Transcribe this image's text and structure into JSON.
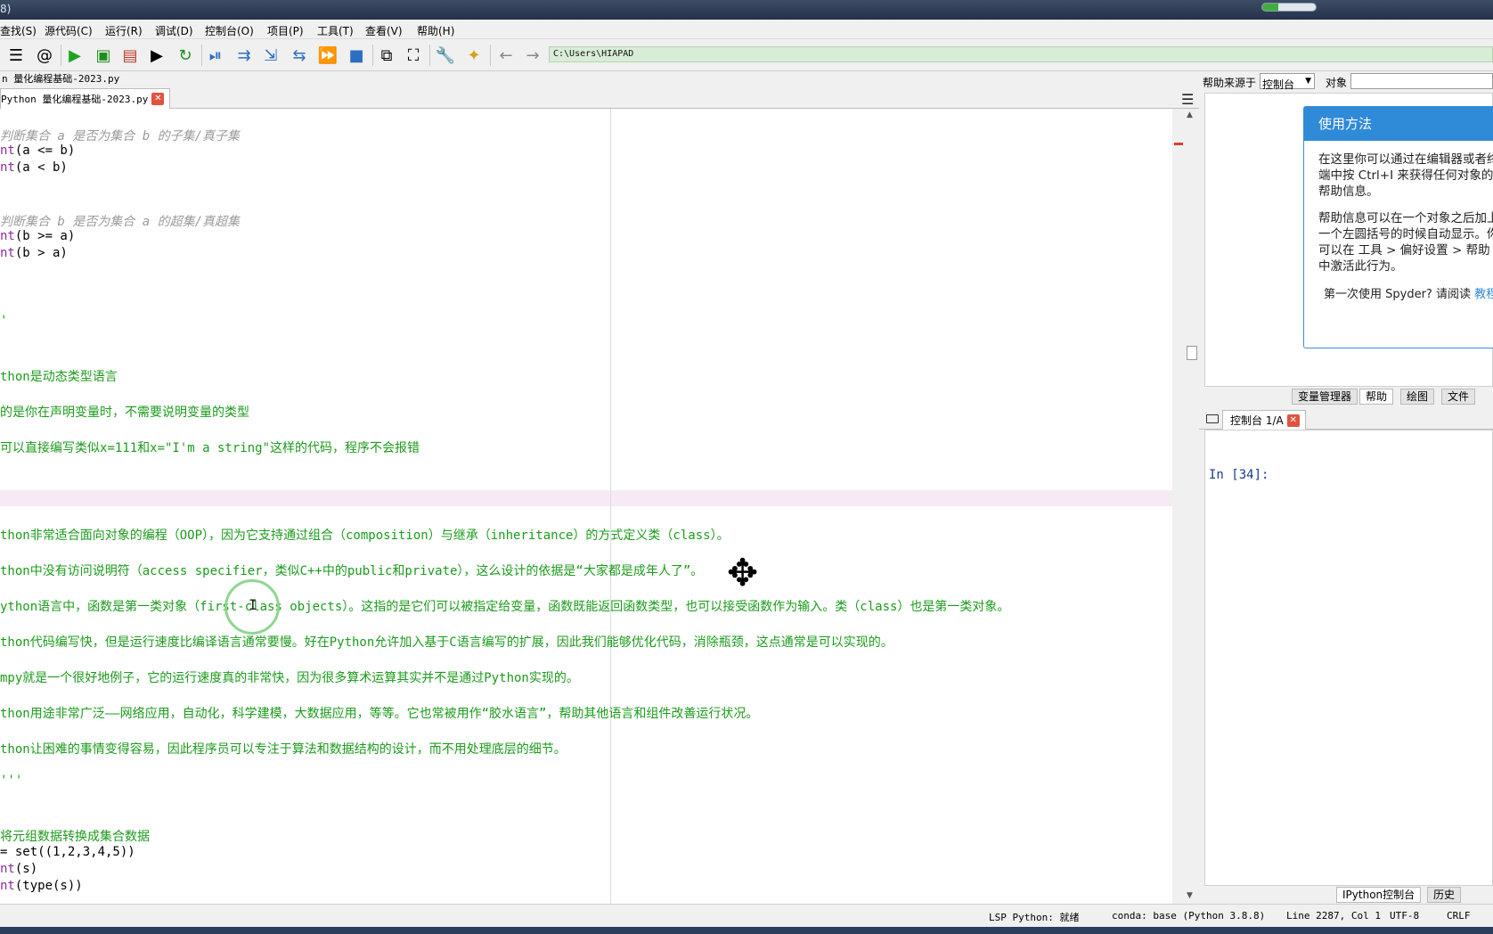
{
  "titlebar": {
    "title": "8)",
    "subtitle": "(...",
    "progress": 0.3
  },
  "menu": [
    "查找(S)",
    "源代码(C)",
    "运行(R)",
    "调试(D)",
    "控制台(O)",
    "项目(P)",
    "工具(T)",
    "查看(V)",
    "帮助(H)"
  ],
  "toolbar": {
    "path": "C:\\Users\\HIAPAD"
  },
  "editor": {
    "file_label": "n 量化编程基础-2023.py",
    "tab_label": "Python 量化编程基础-2023.py",
    "lines": [
      {
        "cls": "c",
        "text": "判断集合 a 是否为集合 b 的子集/真子集"
      },
      {
        "cls": "",
        "kw": "nt",
        "text": "(a <= b)"
      },
      {
        "cls": "",
        "kw": "nt",
        "text": "(a < b)"
      },
      {
        "cls": "c",
        "text": "判断集合 b 是否为集合 a 的超集/真超集"
      },
      {
        "cls": "",
        "kw": "nt",
        "text": "(b >= a)"
      },
      {
        "cls": "",
        "kw": "nt",
        "text": "(b > a)"
      },
      {
        "cls": "g",
        "text": "'"
      },
      {
        "cls": "g",
        "text": "thon是动态类型语言"
      },
      {
        "cls": "g",
        "text": "的是你在声明变量时，不需要说明变量的类型"
      },
      {
        "cls": "g",
        "text": "可以直接编写类似x=111和x=\"I'm a string\"这样的代码，程序不会报错"
      },
      {
        "cls": "g",
        "text": "thon非常适合面向对象的编程（OOP），因为它支持通过组合（composition）与继承（inheritance）的方式定义类（class）。"
      },
      {
        "cls": "g",
        "text": "thon中没有访问说明符（access specifier，类似C++中的public和private），这么设计的依据是“大家都是成年人了”。"
      },
      {
        "cls": "g",
        "text": "ython语言中，函数是第一类对象（first-class objects）。这指的是它们可以被指定给变量，函数既能返回函数类型，也可以接受函数作为输入。类（class）也是第一类对象。"
      },
      {
        "cls": "g",
        "text": "thon代码编写快，但是运行速度比编译语言通常要慢。好在Python允许加入基于C语言编写的扩展，因此我们能够优化代码，消除瓶颈，这点通常是可以实现的。"
      },
      {
        "cls": "g",
        "text": "mpy就是一个很好地例子，它的运行速度真的非常快，因为很多算术运算其实并不是通过Python实现的。"
      },
      {
        "cls": "g",
        "text": "thon用途非常广泛——网络应用，自动化，科学建模，大数据应用，等等。它也常被用作“胶水语言”，帮助其他语言和组件改善运行状况。"
      },
      {
        "cls": "g",
        "text": "thon让困难的事情变得容易，因此程序员可以专注于算法和数据结构的设计，而不用处理底层的细节。"
      },
      {
        "cls": "g",
        "text": "'''"
      },
      {
        "cls": "g",
        "text": "将元组数据转换成集合数据"
      },
      {
        "cls": "",
        "text": "= set((1,2,3,4,5))"
      },
      {
        "cls": "",
        "kw": "nt",
        "text": "(s)"
      },
      {
        "cls": "",
        "kw": "nt",
        "text": "(type(s))"
      }
    ]
  },
  "help": {
    "source_label": "帮助来源于",
    "source_value": "控制台",
    "object_label": "对象",
    "box_title": "使用方法",
    "para1": "在这里你可以通过在编辑器或者终端中按 Ctrl+I 来获得任何对象的帮助信息。",
    "para2": "帮助信息可以在一个对象之后加上一个左圆括号的时候自动显示。你可以在 工具 > 偏好设置 > 帮助 中激活此行为。",
    "foot": "第一次使用 Spyder? 请阅读",
    "foot_link": "教程",
    "tabs": [
      "变量管理器",
      "帮助",
      "绘图",
      "文件"
    ]
  },
  "console": {
    "tab_label": "控制台 1/A",
    "prompt": "In [34]:",
    "bottom_tabs": [
      "IPython控制台",
      "历史"
    ]
  },
  "status": {
    "lsp": "LSP Python: 就绪",
    "conda": "conda: base (Python 3.8.8)",
    "position": "Line 2287, Col 1",
    "encoding": "UTF-8",
    "eol": "CRLF"
  }
}
